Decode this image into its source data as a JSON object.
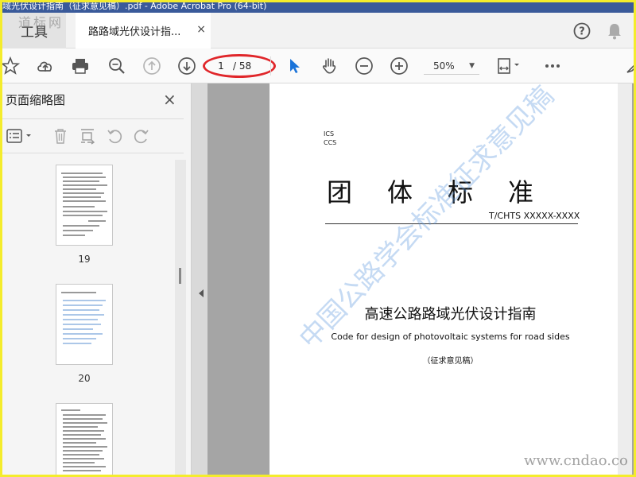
{
  "window": {
    "title": "域光伏设计指南（征求意见稿）.pdf - Adobe Acrobat Pro (64-bit)"
  },
  "tabs": {
    "tools_label": "工具",
    "doc_label": "路路域光伏设计指...",
    "doc_close": "×"
  },
  "toolbar": {
    "page_current": "1",
    "page_total": "/ 58",
    "zoom": "50%",
    "zoom_caret": "▼"
  },
  "sidebar": {
    "title": "页面缩略图",
    "close": "×",
    "thumbnails": [
      {
        "page": "19",
        "style": "dark"
      },
      {
        "page": "20",
        "style": "blue"
      },
      {
        "page": "",
        "style": "dark"
      }
    ]
  },
  "document": {
    "ics": "ICS",
    "ccs": "CCS",
    "standard": "团体标准",
    "code": "T/CHTS  XXXXX-XXXX",
    "title": "高速公路路域光伏设计指南",
    "subtitle": "Code for design of photovoltaic systems for road sides",
    "draft": "（征求意见稿）"
  },
  "watermarks": {
    "logo": "道标网",
    "diagonal": "中国公路学会标准征求意见稿",
    "url": "www.cndao.co"
  },
  "colors": {
    "frame": "#f4ec2c",
    "annotation_ellipse": "#e0262a",
    "select_tool": "#1a73d9"
  }
}
